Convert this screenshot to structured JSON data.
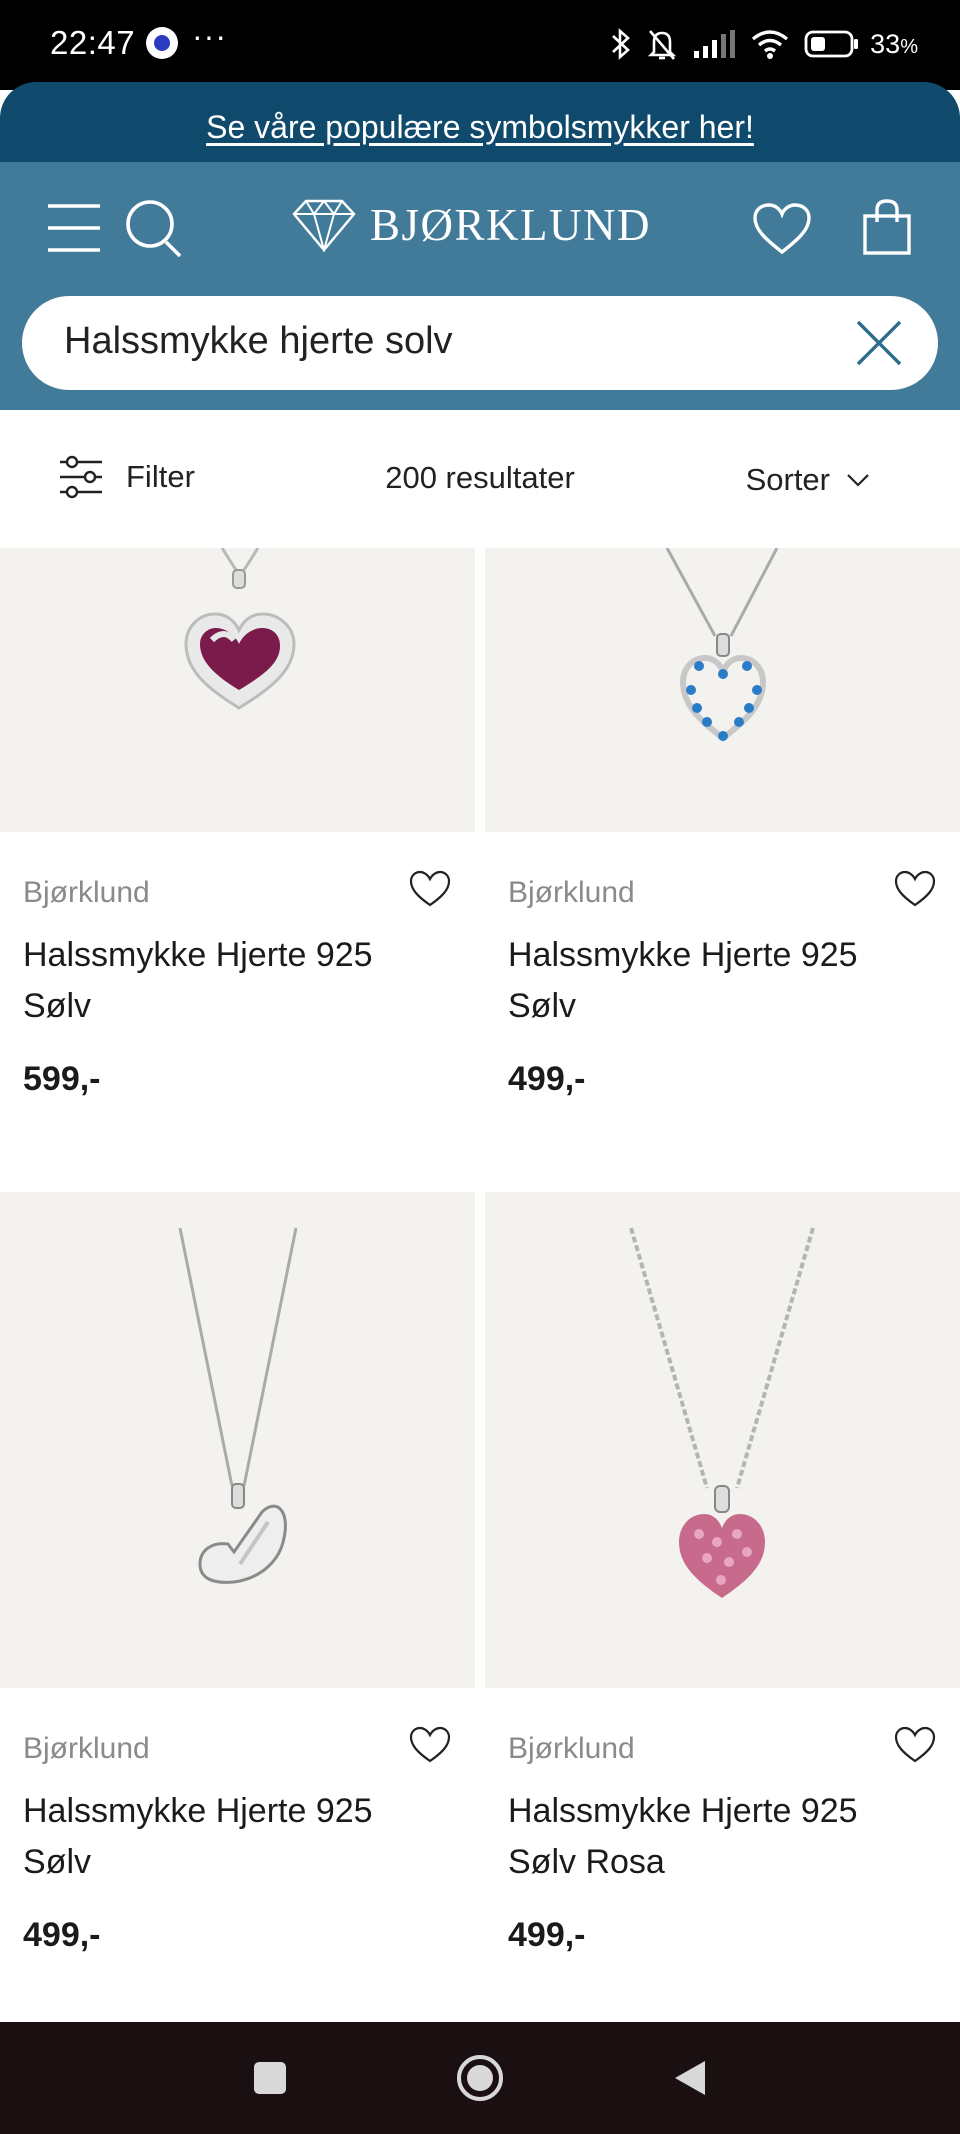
{
  "status_bar": {
    "time": "22:47",
    "dots": "···",
    "battery_percent": "33",
    "battery_suffix": "%",
    "icons": [
      "bluetooth-icon",
      "bell-muted-icon",
      "signal-icon",
      "wifi-icon",
      "battery-icon"
    ]
  },
  "promo": {
    "text": "Se våre populære symbolsmykker her!"
  },
  "header": {
    "logo_text": "BJØRKLUND",
    "icons": [
      "menu-icon",
      "search-icon",
      "diamond-logo-icon",
      "heart-icon",
      "shopping-bag-icon"
    ]
  },
  "search": {
    "query": "Halssmykke hjerte solv"
  },
  "filter_bar": {
    "filter_label": "Filter",
    "result_count": "200 resultater",
    "sort_label": "Sorter"
  },
  "products": [
    {
      "brand": "Bjørklund",
      "title": "Halssmykke Hjerte 925 Sølv",
      "price": "599,-"
    },
    {
      "brand": "Bjørklund",
      "title": "Halssmykke Hjerte 925 Sølv",
      "price": "499,-"
    },
    {
      "brand": "Bjørklund",
      "title": "Halssmykke Hjerte 925 Sølv",
      "price": "499,-"
    },
    {
      "brand": "Bjørklund",
      "title": "Halssmykke Hjerte 925 Sølv Rosa",
      "price": "499,-"
    }
  ],
  "colors": {
    "promo_bg": "#0f4a6c",
    "header_bg": "#417b99",
    "card_bg": "#f3f2ee",
    "nav_bg": "#1a1012"
  }
}
